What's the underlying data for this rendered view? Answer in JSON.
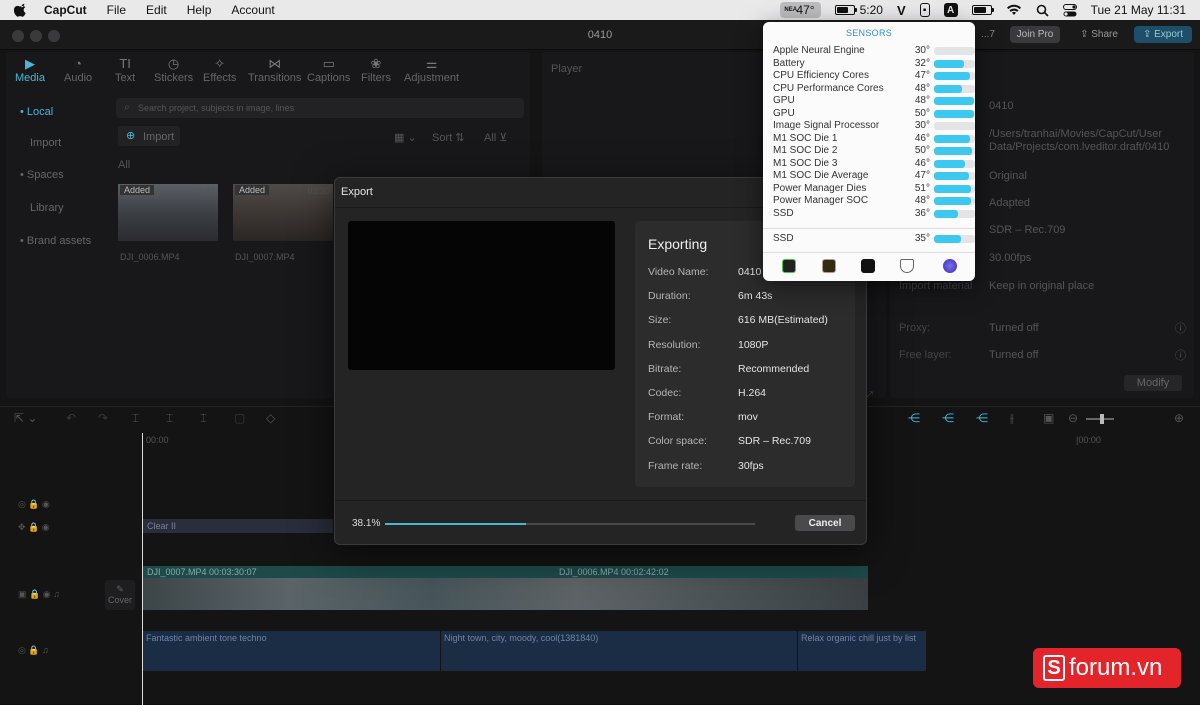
{
  "menubar": {
    "app": "CapCut",
    "items": [
      "File",
      "Edit",
      "Help",
      "Account"
    ],
    "temp": "47°",
    "temp_mini": "NEA",
    "battery_time": "5:20",
    "battery_level": 0.7,
    "v_icon": "V",
    "a_icon": "A",
    "datetime": "Tue 21 May  11:31"
  },
  "window": {
    "title": "0410",
    "join_pro": "Join Pro",
    "share": "Share",
    "export": "Export",
    "truncated": "...7"
  },
  "toolbar": [
    {
      "label": "Media",
      "icon": "▶"
    },
    {
      "label": "Audio",
      "icon": "◔"
    },
    {
      "label": "Text",
      "icon": "TI"
    },
    {
      "label": "Stickers",
      "icon": "◷"
    },
    {
      "label": "Effects",
      "icon": "✧"
    },
    {
      "label": "Transitions",
      "icon": "⋈"
    },
    {
      "label": "Captions",
      "icon": "▭"
    },
    {
      "label": "Filters",
      "icon": "❀"
    },
    {
      "label": "Adjustment",
      "icon": "⚌"
    }
  ],
  "sidebar": [
    "• Local",
    "Import",
    "• Spaces",
    "Library",
    "• Brand assets"
  ],
  "media": {
    "search_placeholder": "Search project, subjects in image, lines",
    "import": "Import",
    "sort": "Sort",
    "all_filter": "All",
    "all_label": "All",
    "clips": [
      {
        "badge": "Added",
        "duration": "02:48",
        "name": "DJI_0006.MP4"
      },
      {
        "badge": "Added",
        "duration": "03:30",
        "name": "DJI_0007.MP4"
      }
    ]
  },
  "player": {
    "label": "Player"
  },
  "details": {
    "values": [
      "0410",
      "/Users/tranhai/Movies/CapCut/User Data/Projects/com.lveditor.draft/0410",
      "Original",
      "Adapted",
      "SDR – Rec.709",
      "30.00fps"
    ],
    "import_material_label": "Import material",
    "import_material_value": "Keep in original place",
    "proxy_label": "Proxy:",
    "proxy_value": "Turned off",
    "free_layer_label": "Free layer:",
    "free_layer_value": "Turned off",
    "modify": "Modify"
  },
  "timeline": {
    "time_start": "00:00",
    "time_end": "|00:00",
    "clear": "Clear II",
    "cover": "Cover",
    "clip1": "DJI_0007.MP4  00:03:30:07",
    "clip2": "DJI_0006.MP4  00:02:42:02",
    "audio": [
      "Fantastic ambient tone techno",
      "Night town, city, moody, cool(1381840)",
      "Relax organic chill just by list"
    ]
  },
  "export_modal": {
    "title": "Export",
    "heading": "Exporting",
    "rows": [
      {
        "k": "Video Name:",
        "v": "0410"
      },
      {
        "k": "Duration:",
        "v": "6m 43s"
      },
      {
        "k": "Size:",
        "v": "616 MB(Estimated)"
      },
      {
        "k": "Resolution:",
        "v": "1080P"
      },
      {
        "k": "Bitrate:",
        "v": "Recommended"
      },
      {
        "k": "Codec:",
        "v": "H.264"
      },
      {
        "k": "Format:",
        "v": "mov"
      },
      {
        "k": "Color space:",
        "v": "SDR – Rec.709"
      },
      {
        "k": "Frame rate:",
        "v": "30fps"
      }
    ],
    "progress_text": "38.1%",
    "progress": 0.381,
    "cancel": "Cancel"
  },
  "sensors": {
    "title": "SENSORS",
    "items": [
      {
        "name": "Apple Neural Engine",
        "temp": "30°",
        "level": 0.0
      },
      {
        "name": "Battery",
        "temp": "32°",
        "level": 0.72
      },
      {
        "name": "CPU Efficiency Cores",
        "temp": "47°",
        "level": 0.88
      },
      {
        "name": "CPU Performance Cores",
        "temp": "48°",
        "level": 0.68
      },
      {
        "name": "GPU",
        "temp": "48°",
        "level": 0.98
      },
      {
        "name": "GPU",
        "temp": "50°",
        "level": 0.98
      },
      {
        "name": "Image Signal Processor",
        "temp": "30°",
        "level": 0.0
      },
      {
        "name": "M1 SOC Die 1",
        "temp": "46°",
        "level": 0.88
      },
      {
        "name": "M1 SOC Die 2",
        "temp": "50°",
        "level": 0.92
      },
      {
        "name": "M1 SOC Die 3",
        "temp": "46°",
        "level": 0.75
      },
      {
        "name": "M1 SOC Die Average",
        "temp": "47°",
        "level": 0.85
      },
      {
        "name": "Power Manager Dies",
        "temp": "51°",
        "level": 0.9
      },
      {
        "name": "Power Manager SOC",
        "temp": "48°",
        "level": 0.9
      },
      {
        "name": "SSD",
        "temp": "36°",
        "level": 0.58
      }
    ],
    "ssd": {
      "name": "SSD",
      "temp": "35°",
      "level": 0.65
    }
  },
  "watermark": {
    "s": "S",
    "text": "forum.vn"
  },
  "colors": {
    "accent": "#4ab6d3",
    "sensor_bar": "#3dc8ef",
    "watermark": "#e3242b"
  }
}
